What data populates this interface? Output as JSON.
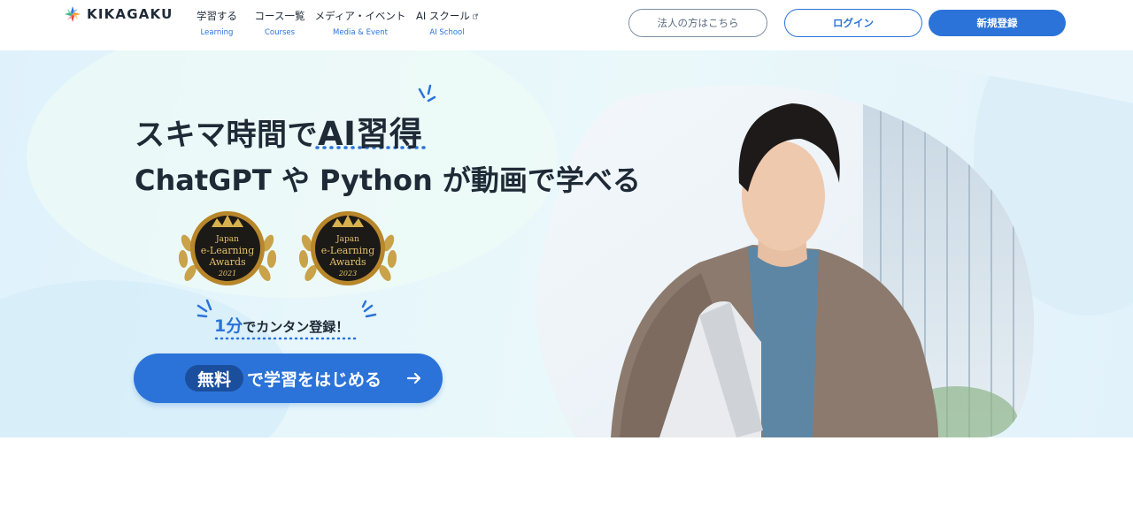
{
  "brand": {
    "name": "KIKAGAKU"
  },
  "nav": [
    {
      "label": "学習する",
      "sub": "Learning"
    },
    {
      "label": "コース一覧",
      "sub": "Courses"
    },
    {
      "label": "メディア・イベント",
      "sub": "Media & Event"
    },
    {
      "label": "AI スクール",
      "sub": "AI School",
      "icon": "external-link-icon"
    }
  ],
  "header_buttons": {
    "corporate": "法人の方はこちら",
    "login": "ログイン",
    "signup": "新規登録"
  },
  "hero": {
    "headline_prefix": "スキマ時間で",
    "headline_highlight": "AI習得",
    "subheadline": "ChatGPT や Python が動画で学べる",
    "awards": [
      {
        "line1": "Japan",
        "line2": "e-Learning",
        "line3": "Awards",
        "year": "2021"
      },
      {
        "line1": "Japan",
        "line2": "e-Learning",
        "line3": "Awards",
        "year": "2023"
      }
    ],
    "quick_signup_num": "1分",
    "quick_signup_text": "でカンタン登録！",
    "cta_badge": "無料",
    "cta_text": "で学習をはじめる"
  },
  "colors": {
    "accent": "#2b73d8",
    "accent_dark": "#1b4f9e",
    "text": "#1f2a37",
    "hero_bg": "#e4f4fb"
  }
}
